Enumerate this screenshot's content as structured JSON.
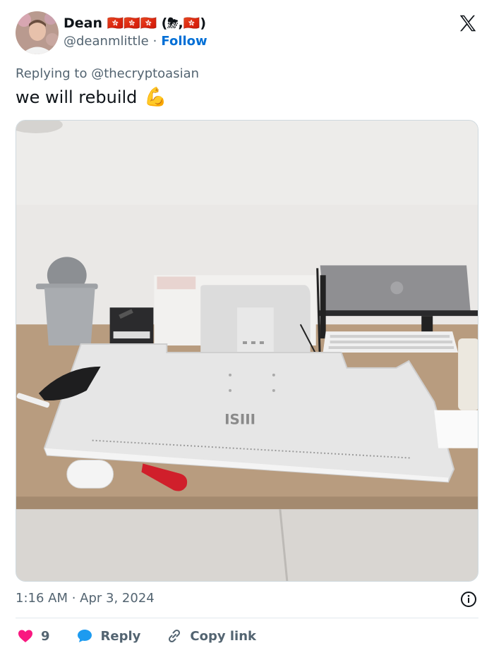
{
  "author": {
    "display_name": "Dean 🇭🇰🇭🇰🇭🇰",
    "name_suffix": "(⛈,🇭🇰)",
    "handle": "@deanmlittle",
    "separator": "·",
    "follow_label": "Follow"
  },
  "tweet": {
    "reply_to_label": "Replying to @thecryptoasian",
    "text": "we will rebuild",
    "emoji": "💪",
    "timestamp": "1:16 AM · Apr 3, 2024"
  },
  "actions": {
    "likes_count": "9",
    "reply_label": "Reply",
    "copy_link_label": "Copy link"
  },
  "photo": {
    "monitor_brand": "ISIII"
  },
  "colors": {
    "like": "#f91880",
    "reply": "#1d9bf0",
    "follow": "#006fd6",
    "muted": "#536471"
  },
  "icons": [
    "x-logo-icon",
    "info-icon",
    "heart-icon",
    "reply-bubble-icon",
    "link-icon",
    "flexed-biceps-emoji"
  ]
}
